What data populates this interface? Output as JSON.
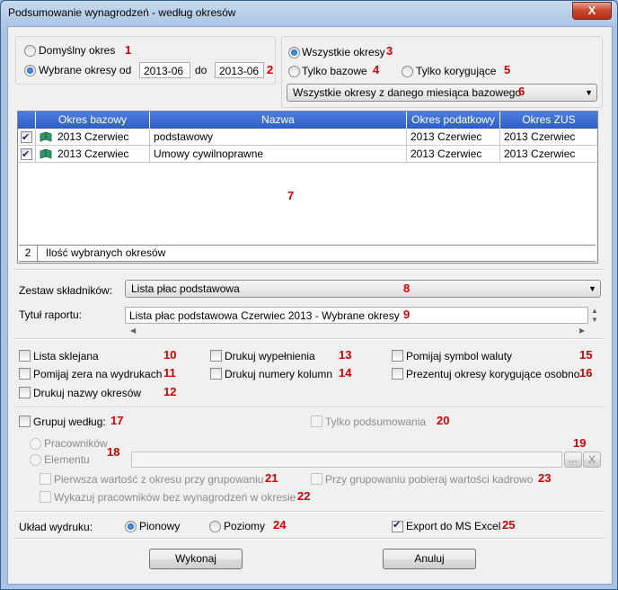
{
  "window": {
    "title": "Podsumowanie wynagrodzeń - według okresów",
    "close_label": "X"
  },
  "period": {
    "default_label": "Domyślny  okres",
    "selected_label": "Wybrane okresy od",
    "from_value": "2013-06",
    "to_label": "do",
    "to_value": "2013-06",
    "selected_mode": "selected"
  },
  "filter": {
    "all_label": "Wszystkie okresy",
    "base_label": "Tylko bazowe",
    "corr_label": "Tylko korygujące",
    "selected": "all",
    "combo_value": "Wszystkie okresy z danego miesiąca bazowego"
  },
  "table": {
    "columns": [
      "Okres bazowy",
      "Nazwa",
      "Okres podatkowy",
      "Okres ZUS"
    ],
    "rows": [
      {
        "checked": true,
        "base": "2013 Czerwiec",
        "name": "podstawowy",
        "tax": "2013 Czerwiec",
        "zus": "2013 Czerwiec"
      },
      {
        "checked": true,
        "base": "2013 Czerwiec",
        "name": "Umowy cywilnoprawne",
        "tax": "2013 Czerwiec",
        "zus": "2013 Czerwiec"
      }
    ],
    "footer_count": "2",
    "footer_label": "Ilość wybranych okresów"
  },
  "components": {
    "label": "Zestaw składników:",
    "value": "Lista płac podstawowa"
  },
  "report_title": {
    "label": "Tytuł raportu:",
    "value": "Lista płac podstawowa  Czerwiec 2013 - Wybrane okresy"
  },
  "options": {
    "lista_sklejana": {
      "label": "Lista sklejana",
      "checked": false
    },
    "pomijaj_zera": {
      "label": "Pomijaj zera na wydrukach",
      "checked": false
    },
    "drukuj_nazwy": {
      "label": "Drukuj nazwy okresów",
      "checked": false
    },
    "drukuj_wypelnienia": {
      "label": "Drukuj wypełnienia",
      "checked": false
    },
    "drukuj_numery": {
      "label": "Drukuj numery kolumn",
      "checked": false
    },
    "pomijaj_symbol": {
      "label": "Pomijaj symbol waluty",
      "checked": false
    },
    "prezentuj_okresy": {
      "label": "Prezentuj okresy korygujące osobno",
      "checked": false
    }
  },
  "grouping": {
    "group_label": "Grupuj według:",
    "summary_label": "Tylko podsumowania",
    "employees_label": "Pracowników",
    "element_label": "Elementu",
    "element_value": "",
    "browse_label": "...",
    "clear_label": "X",
    "first_value_label": "Pierwsza wartość z okresu przy grupowaniu",
    "hr_values_label": "Przy grupowaniu pobieraj wartości kadrowo",
    "no_salary_label": "Wykazuj pracowników bez wynagrodzeń w okresie"
  },
  "layout_opts": {
    "label": "Układ wydruku:",
    "portrait_label": "Pionowy",
    "landscape_label": "Poziomy",
    "orientation": "portrait",
    "excel_label": "Export do MS Excel",
    "excel_checked": true
  },
  "buttons": {
    "run": "Wykonaj",
    "cancel": "Anuluj"
  },
  "markers": [
    "1",
    "2",
    "3",
    "4",
    "5",
    "6",
    "7",
    "8",
    "9",
    "10",
    "11",
    "12",
    "13",
    "14",
    "15",
    "16",
    "17",
    "18",
    "19",
    "20",
    "21",
    "22",
    "23",
    "24",
    "25"
  ],
  "colors": {
    "marker": "#d00000",
    "grid_header": "#2e5fc8"
  }
}
